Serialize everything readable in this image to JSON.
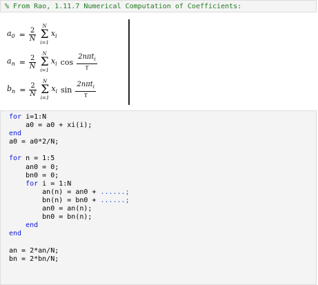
{
  "comment": "% From Rao, 1.11.7 Numerical Computation of Coefficients:",
  "equations": {
    "eq1": {
      "lhs": "a",
      "lhs_sub": "0",
      "frac_num": "2",
      "frac_den": "N",
      "sum_top": "N",
      "sum_bot": "i=1",
      "term": "x",
      "term_sub": "i"
    },
    "eq2": {
      "lhs": "a",
      "lhs_sub": "n",
      "frac_num": "2",
      "frac_den": "N",
      "sum_top": "N",
      "sum_bot": "i=1",
      "term": "x",
      "term_sub": "i",
      "func": "cos",
      "arg_num": "2nπt",
      "arg_num_sub": "i",
      "arg_den": "τ"
    },
    "eq3": {
      "lhs": "b",
      "lhs_sub": "n",
      "frac_num": "2",
      "frac_den": "N",
      "sum_top": "N",
      "sum_bot": "i=1",
      "term": "x",
      "term_sub": "i",
      "func": "sin",
      "arg_num": "2nπt",
      "arg_num_sub": "i",
      "arg_den": "τ"
    }
  },
  "code": {
    "l1_kw": "for",
    "l1": " i=1:N",
    "l2": "    a0 = a0 + xi(i);",
    "l3_kw": "end",
    "l4": "a0 = a0*2/N;",
    "l5": "",
    "l6_kw": "for",
    "l6": " n = 1:5",
    "l7": "    an0 = 0;",
    "l8": "    bn0 = 0;",
    "l9_kw": "    for",
    "l9": " i = 1:N",
    "l10": "        an(n) = an0 + ",
    "l10_dots": "......;",
    "l11": "        bn(n) = bn0 + ",
    "l11_dots": "......;",
    "l12": "        an0 = an(n);",
    "l13": "        bn0 = bn(n);",
    "l14_kw": "    end",
    "l15_kw": "end",
    "l16": "",
    "l17": "an = 2*an/N;",
    "l18": "bn = 2*bn/N;"
  }
}
